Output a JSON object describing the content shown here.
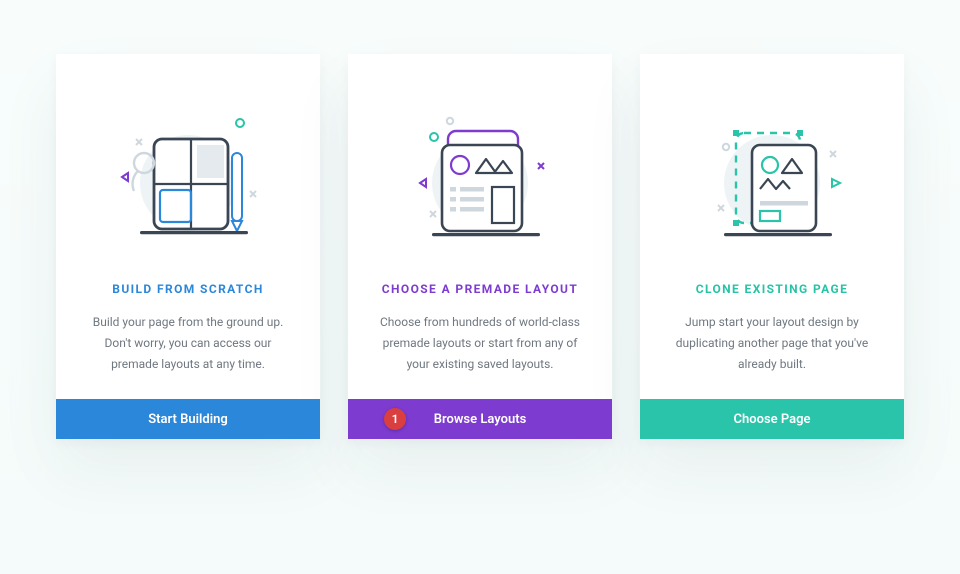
{
  "cards": {
    "scratch": {
      "title": "BUILD FROM SCRATCH",
      "desc": "Build your page from the ground up. Don't worry, you can access our premade layouts at any time.",
      "button": "Start Building"
    },
    "premade": {
      "title": "CHOOSE A PREMADE LAYOUT",
      "desc": "Choose from hundreds of world-class premade layouts or start from any of your existing saved layouts.",
      "button": "Browse Layouts",
      "badge": "1"
    },
    "clone": {
      "title": "CLONE EXISTING PAGE",
      "desc": "Jump start your layout design by duplicating another page that you've already built.",
      "button": "Choose Page"
    }
  }
}
